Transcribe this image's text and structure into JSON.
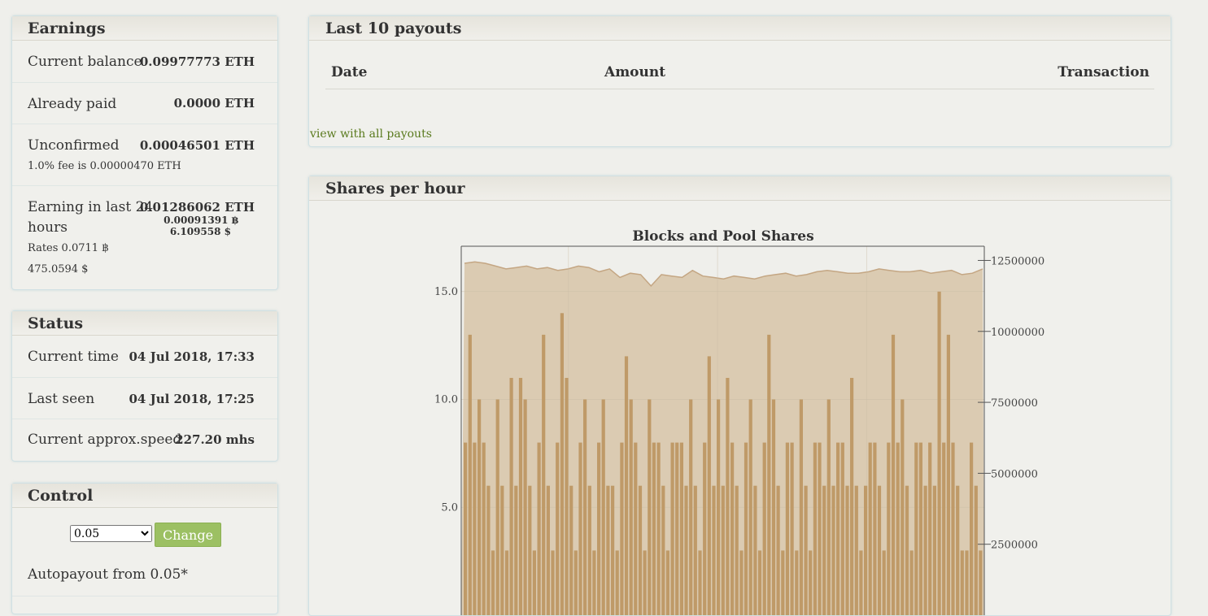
{
  "earnings": {
    "title": "Earnings",
    "current_balance_label": "Current balance",
    "current_balance_value": "0.09977773 ETH",
    "already_paid_label": "Already paid",
    "already_paid_value": "0.0000 ETH",
    "unconfirmed_label": "Unconfirmed",
    "unconfirmed_value": "0.00046501 ETH",
    "fee_note": "1.0% fee is 0.00000470 ETH",
    "last24_label_1": "Earning in last 24",
    "last24_label_2": "hours",
    "last24_eth": "0.01286062 ETH",
    "last24_btc": "0.00091391 ฿",
    "last24_usd": "6.109558 $",
    "rates_btc": "Rates 0.0711 ฿",
    "rates_usd": "475.0594 $"
  },
  "status": {
    "title": "Status",
    "current_time_label": "Current time",
    "current_time_value": "04 Jul 2018, 17:33",
    "last_seen_label": "Last seen",
    "last_seen_value": "04 Jul 2018, 17:25",
    "speed_label": "Current approx.speed",
    "speed_value": "227.20 mhs"
  },
  "control": {
    "title": "Control",
    "select_value": "0.05",
    "change_button": "Change",
    "autopayout_text": "Autopayout from 0.05*"
  },
  "payouts": {
    "title": "Last 10 payouts",
    "col_date": "Date",
    "col_amount": "Amount",
    "col_transaction": "Transaction",
    "view_all_link": "view with all payouts"
  },
  "shares": {
    "title": "Shares per hour"
  },
  "colors": {
    "bar": "#bf9a68",
    "area_fill": "#dbcbb2",
    "area_line": "#c4a683",
    "button": "#9cc063",
    "link": "#5a7a1e"
  },
  "chart_data": {
    "type": "bar",
    "title": "Blocks and Pool Shares",
    "left_axis_ticks": [
      "5.0",
      "10.0",
      "15.0"
    ],
    "right_axis_ticks": [
      "2500000",
      "5000000",
      "7500000",
      "10000000",
      "12500000"
    ],
    "left_ylim": [
      0,
      17.1
    ],
    "right_ylim": [
      0,
      13000000
    ],
    "grid": true,
    "series": [
      {
        "kind": "bar",
        "axis": "left",
        "values": [
          8,
          13,
          8,
          10,
          8,
          6,
          3,
          10,
          6,
          3,
          11,
          6,
          11,
          10,
          6,
          3,
          8,
          13,
          6,
          3,
          8,
          14,
          11,
          6,
          3,
          8,
          10,
          6,
          3,
          8,
          10,
          6,
          6,
          3,
          8,
          12,
          10,
          8,
          6,
          3,
          10,
          8,
          8,
          6,
          3,
          8,
          8,
          8,
          6,
          10,
          6,
          3,
          8,
          12,
          6,
          10,
          6,
          11,
          8,
          6,
          3,
          8,
          10,
          6,
          3,
          8,
          13,
          10,
          6,
          3,
          8,
          8,
          3,
          10,
          6,
          3,
          8,
          8,
          6,
          10,
          6,
          8,
          8,
          6,
          11,
          6,
          3,
          6,
          8,
          8,
          6,
          3,
          8,
          13,
          8,
          10,
          6,
          3,
          8,
          8,
          6,
          8,
          6,
          15,
          8,
          13,
          8,
          6,
          3,
          3,
          8,
          6,
          3
        ]
      },
      {
        "kind": "area",
        "axis": "right",
        "values": [
          12400000,
          12450000,
          12400000,
          12300000,
          12200000,
          12250000,
          12300000,
          12200000,
          12250000,
          12150000,
          12200000,
          12300000,
          12250000,
          12100000,
          12200000,
          11900000,
          12050000,
          12000000,
          11600000,
          12000000,
          11950000,
          11900000,
          12150000,
          11950000,
          11900000,
          11850000,
          11950000,
          11900000,
          11850000,
          11950000,
          12000000,
          12050000,
          11950000,
          12000000,
          12100000,
          12150000,
          12100000,
          12050000,
          12050000,
          12100000,
          12200000,
          12150000,
          12100000,
          12100000,
          12150000,
          12050000,
          12100000,
          12150000,
          12000000,
          12050000,
          12200000
        ]
      }
    ]
  }
}
